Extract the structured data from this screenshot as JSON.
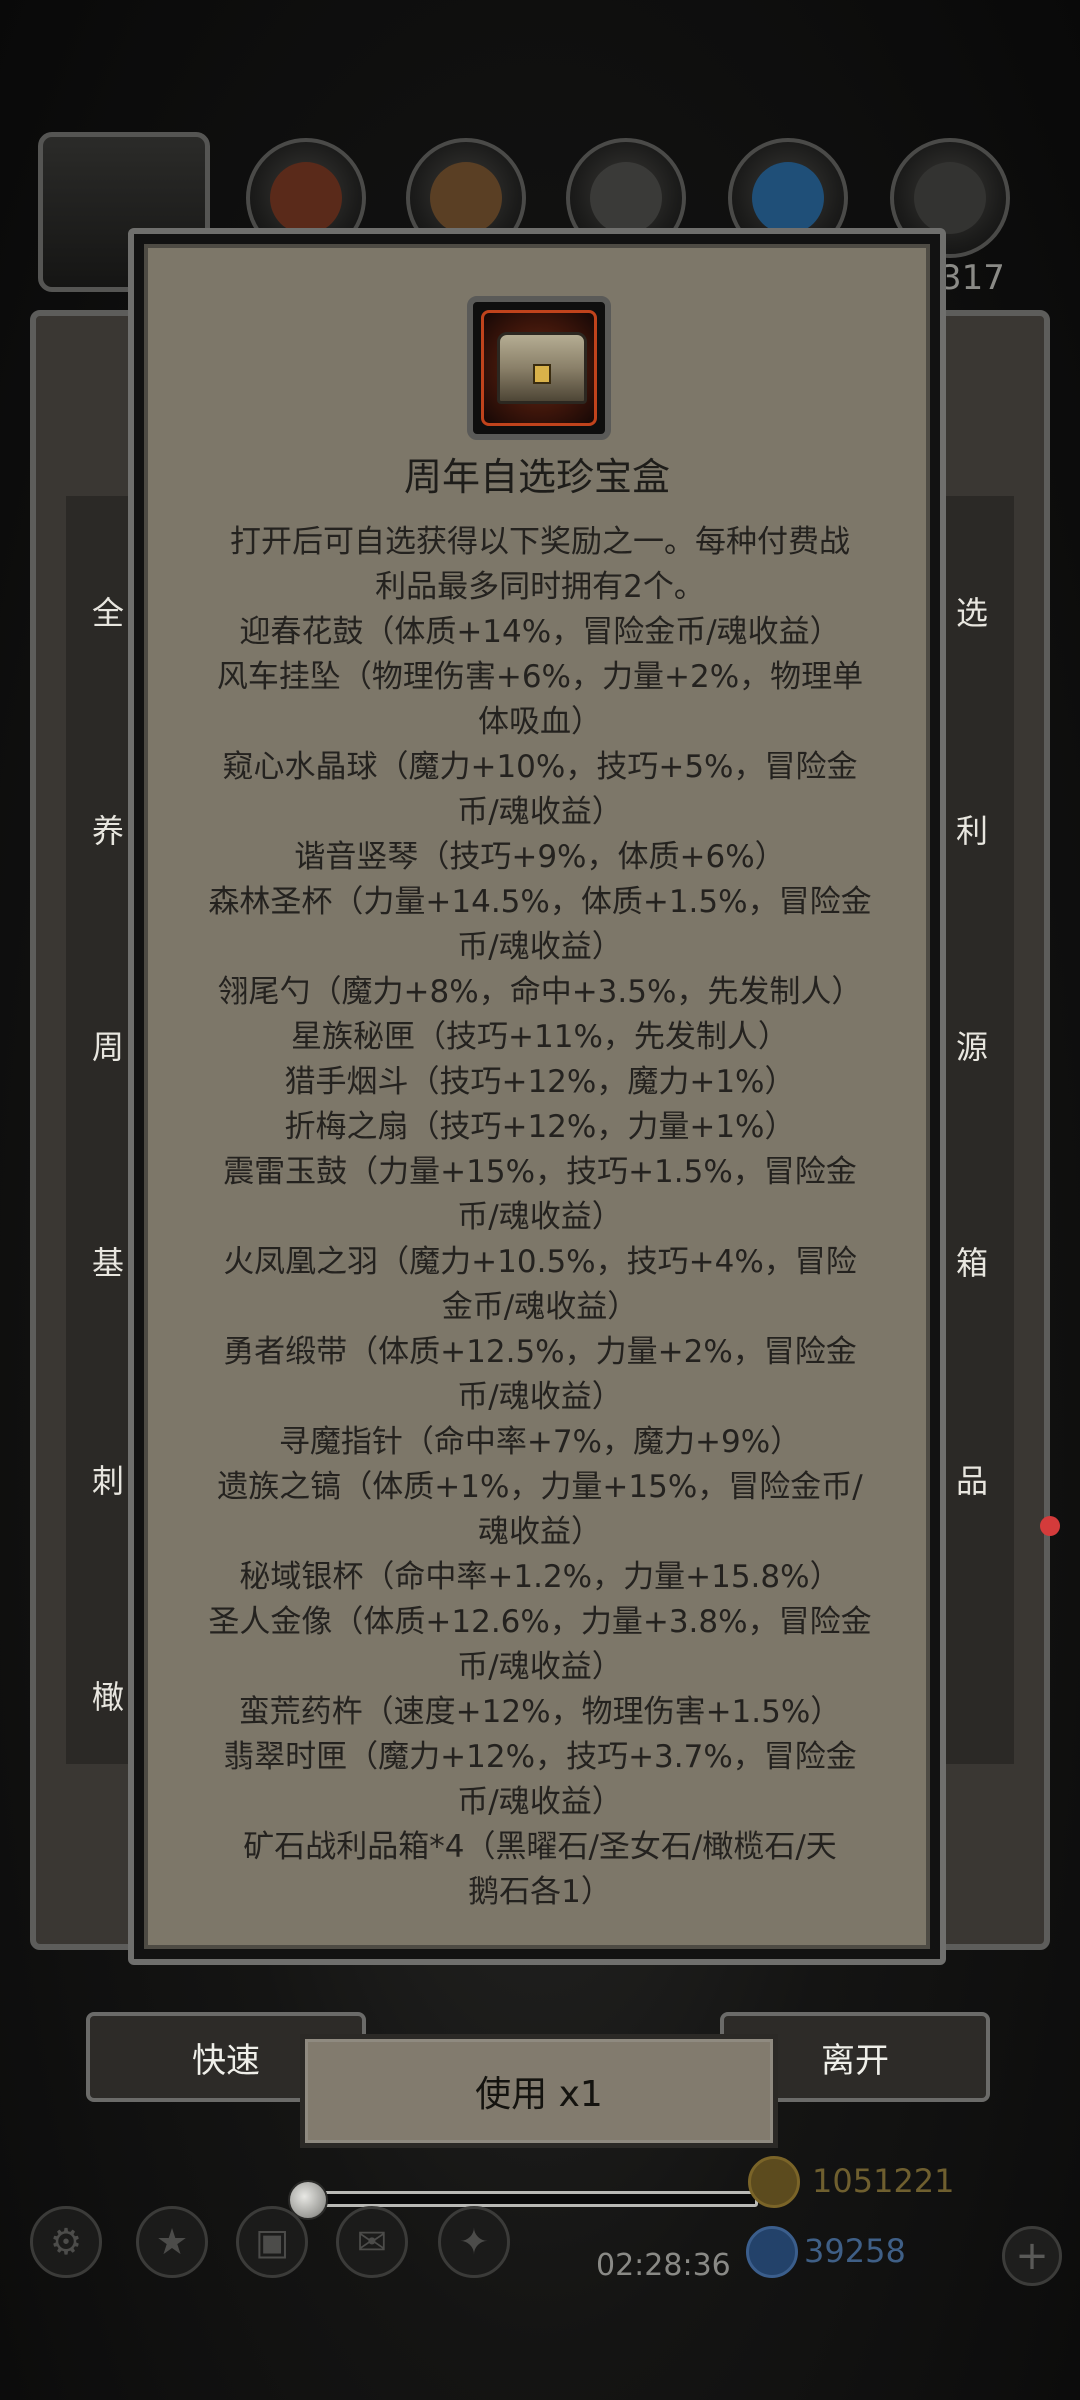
{
  "header": {
    "counter_partial": "317"
  },
  "side_left": [
    "全",
    "养",
    "周",
    "基",
    "刺",
    "橄"
  ],
  "side_right": [
    "选",
    "利",
    "源",
    "箱",
    "品"
  ],
  "bottom_bar": {
    "quick_label": "快速",
    "leave_label": "离开"
  },
  "dialog": {
    "title": "周年自选珍宝盒",
    "lines": [
      "打开后可自选获得以下奖励之一。每种付费战",
      "利品最多同时拥有2个。",
      "迎春花鼓（体质+14%，冒险金币/魂收益）",
      "风车挂坠（物理伤害+6%，力量+2%，物理单",
      "体吸血）",
      "窥心水晶球（魔力+10%，技巧+5%，冒险金",
      "币/魂收益）",
      "谐音竖琴（技巧+9%，体质+6%）",
      "森林圣杯（力量+14.5%，体质+1.5%，冒险金",
      "币/魂收益）",
      "翎尾勺（魔力+8%，命中+3.5%，先发制人）",
      "星族秘匣（技巧+11%，先发制人）",
      "猎手烟斗（技巧+12%，魔力+1%）",
      "折梅之扇（技巧+12%，力量+1%）",
      "震雷玉鼓（力量+15%，技巧+1.5%，冒险金",
      "币/魂收益）",
      "火凤凰之羽（魔力+10.5%，技巧+4%，冒险",
      "金币/魂收益）",
      "勇者缎带（体质+12.5%，力量+2%，冒险金",
      "币/魂收益）",
      "寻魔指针（命中率+7%，魔力+9%）",
      "遗族之镐（体质+1%，力量+15%，冒险金币/",
      "魂收益）",
      "秘域银杯（命中率+1.2%，力量+15.8%）",
      "圣人金像（体质+12.6%，力量+3.8%，冒险金",
      "币/魂收益）",
      "蛮荒药杵（速度+12%，物理伤害+1.5%）",
      "翡翠时匣（魔力+12%，技巧+3.7%，冒险金",
      "币/魂收益）",
      "矿石战利品箱*4（黑曜石/圣女石/橄榄石/天",
      "鹅石各1）"
    ],
    "use_button": "使用  x1"
  },
  "status": {
    "timer": "02:28:36",
    "gold": "1051221",
    "gems": "39258"
  },
  "icons": {
    "chest": "treasure-chest-icon",
    "gold": "gold-coin-icon",
    "gem": "blue-gem-icon",
    "plus": "plus-icon"
  }
}
